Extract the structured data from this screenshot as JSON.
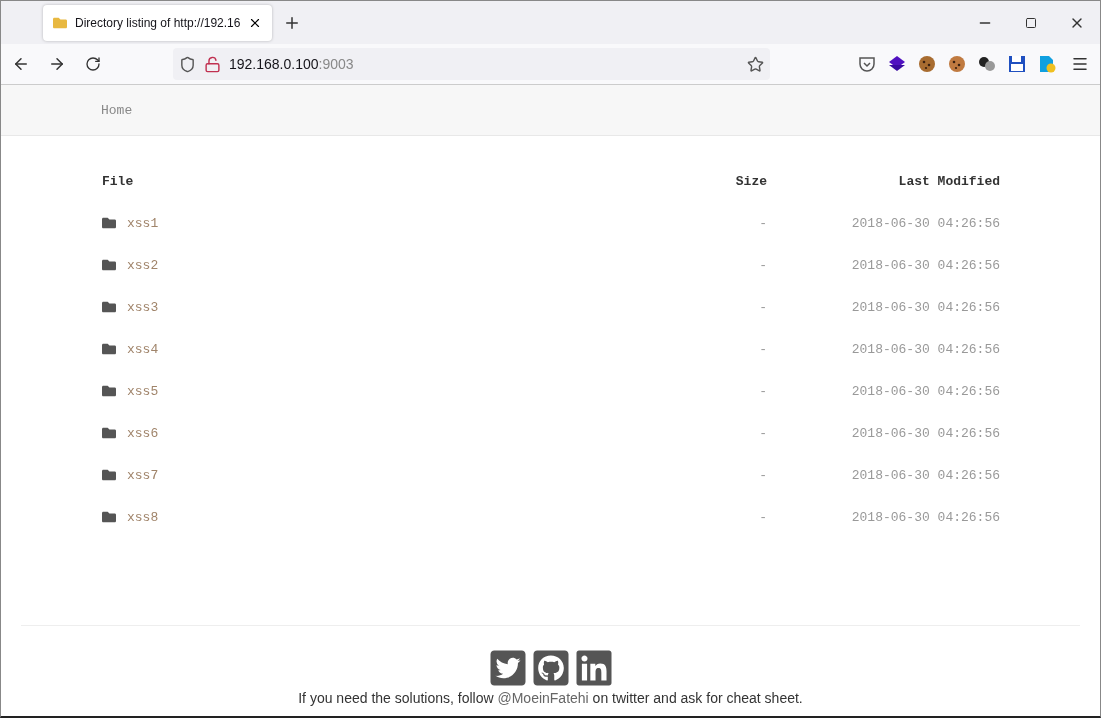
{
  "browser": {
    "tab_title": "Directory listing of http://192.16",
    "url_host": "192.168.0.100",
    "url_port": ":9003"
  },
  "breadcrumb": [
    "Home"
  ],
  "table": {
    "columns": [
      "File",
      "Size",
      "Last Modified"
    ],
    "rows": [
      {
        "name": "xss1",
        "size": "-",
        "modified": "2018-06-30 04:26:56"
      },
      {
        "name": "xss2",
        "size": "-",
        "modified": "2018-06-30 04:26:56"
      },
      {
        "name": "xss3",
        "size": "-",
        "modified": "2018-06-30 04:26:56"
      },
      {
        "name": "xss4",
        "size": "-",
        "modified": "2018-06-30 04:26:56"
      },
      {
        "name": "xss5",
        "size": "-",
        "modified": "2018-06-30 04:26:56"
      },
      {
        "name": "xss6",
        "size": "-",
        "modified": "2018-06-30 04:26:56"
      },
      {
        "name": "xss7",
        "size": "-",
        "modified": "2018-06-30 04:26:56"
      },
      {
        "name": "xss8",
        "size": "-",
        "modified": "2018-06-30 04:26:56"
      }
    ]
  },
  "footer": {
    "before": "If you need the solutions, follow ",
    "link": "@MoeinFatehi",
    "after": " on twitter and ask for cheat sheet."
  }
}
